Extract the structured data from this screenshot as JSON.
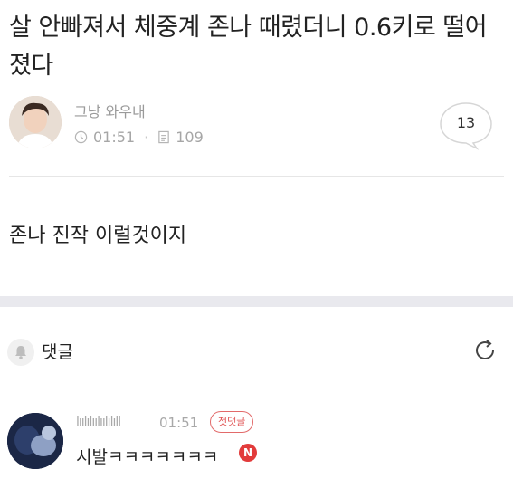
{
  "post": {
    "title": "살 안빠져서 체중계 존나 때렸더니 0.6키로 떨어졌다",
    "author": "그냥 와우내",
    "time": "01:51",
    "views": "109",
    "comment_count": "13",
    "body": "존나 진작 이럴것이지"
  },
  "comments_section": {
    "label": "댓글"
  },
  "comments": [
    {
      "author": "lıılılıılıılılıll",
      "time": "01:51",
      "badge": "첫댓글",
      "text": "시발ㅋㅋㅋㅋㅋㅋㅋ",
      "new_badge": "N"
    }
  ],
  "icons": {
    "clock": "clock-icon",
    "views": "document-icon",
    "comment": "speech-bubble-icon",
    "bell": "bell-icon",
    "refresh": "refresh-icon"
  },
  "colors": {
    "accent_red": "#e23b3b",
    "muted_text": "#a6a6a6",
    "section_divider": "#e9e9ee"
  }
}
